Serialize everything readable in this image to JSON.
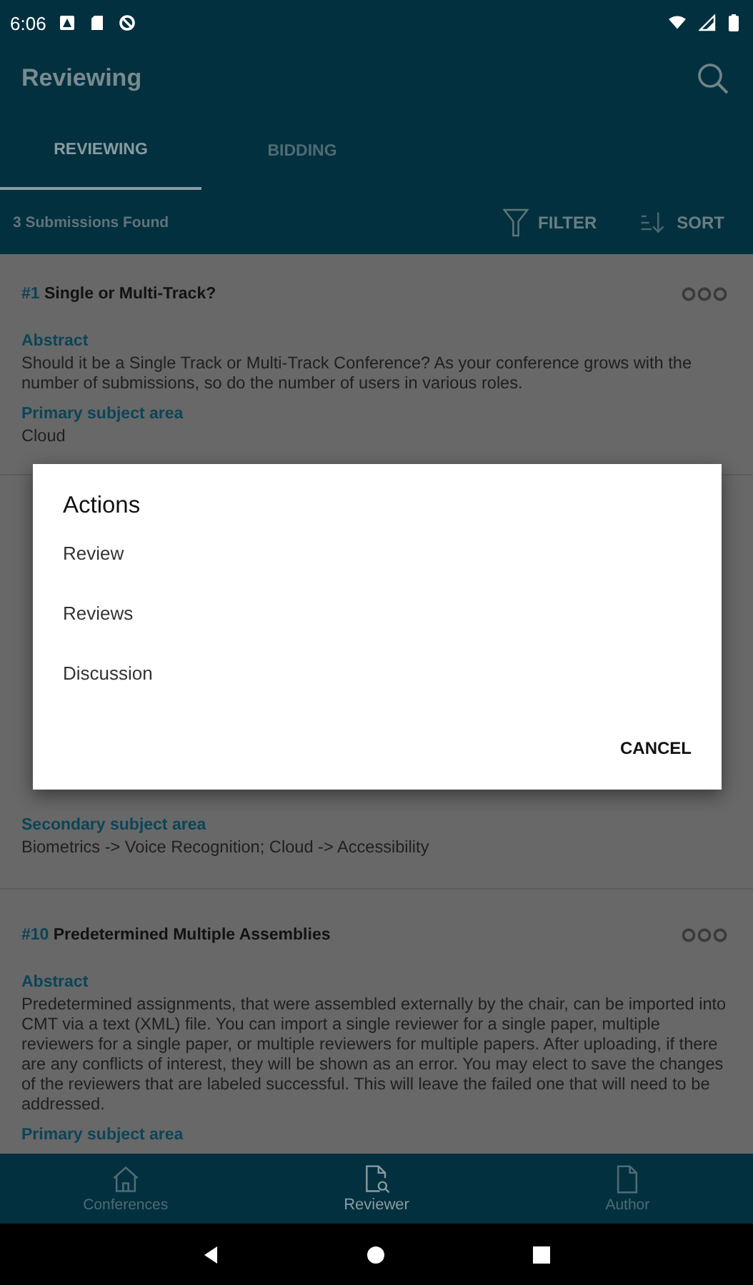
{
  "status_bar": {
    "time": "6:06"
  },
  "app_bar": {
    "title": "Reviewing"
  },
  "tabs": [
    {
      "label": "REVIEWING",
      "selected": true
    },
    {
      "label": "BIDDING",
      "selected": false
    }
  ],
  "toolbar": {
    "count": "3 Submissions Found",
    "filter": "FILTER",
    "sort": "SORT"
  },
  "submissions": [
    {
      "number": "#1",
      "title": "Single or Multi-Track?",
      "sections": [
        {
          "label": "Abstract",
          "text": "Should it be a Single Track or Multi-Track Conference?  As your conference grows with the number of submissions, so do the number of users in various roles."
        },
        {
          "label": "Primary subject area",
          "text": "Cloud"
        }
      ]
    },
    {
      "sections": [
        {
          "label": "Secondary subject area",
          "text": "Biometrics -> Voice Recognition; Cloud -> Accessibility"
        }
      ]
    },
    {
      "number": "#10",
      "title": "Predetermined Multiple Assemblies",
      "sections": [
        {
          "label": "Abstract",
          "text": "Predetermined assignments, that were assembled externally by the chair, can be imported into CMT via a text (XML) file. You can import a single reviewer for a single paper, multiple reviewers for a single paper, or multiple reviewers for multiple papers. After uploading, if there are any conflicts of interest, they will be shown as an error.  You may elect to save the changes of the reviewers that are labeled successful. This will leave the failed one that will need to be addressed."
        },
        {
          "label": "Primary subject area"
        }
      ]
    }
  ],
  "dialog": {
    "title": "Actions",
    "items": [
      "Review",
      "Reviews",
      "Discussion"
    ],
    "cancel": "CANCEL"
  },
  "bottom_nav": [
    {
      "label": "Conferences",
      "selected": false
    },
    {
      "label": "Reviewer",
      "selected": true
    },
    {
      "label": "Author",
      "selected": false
    }
  ]
}
